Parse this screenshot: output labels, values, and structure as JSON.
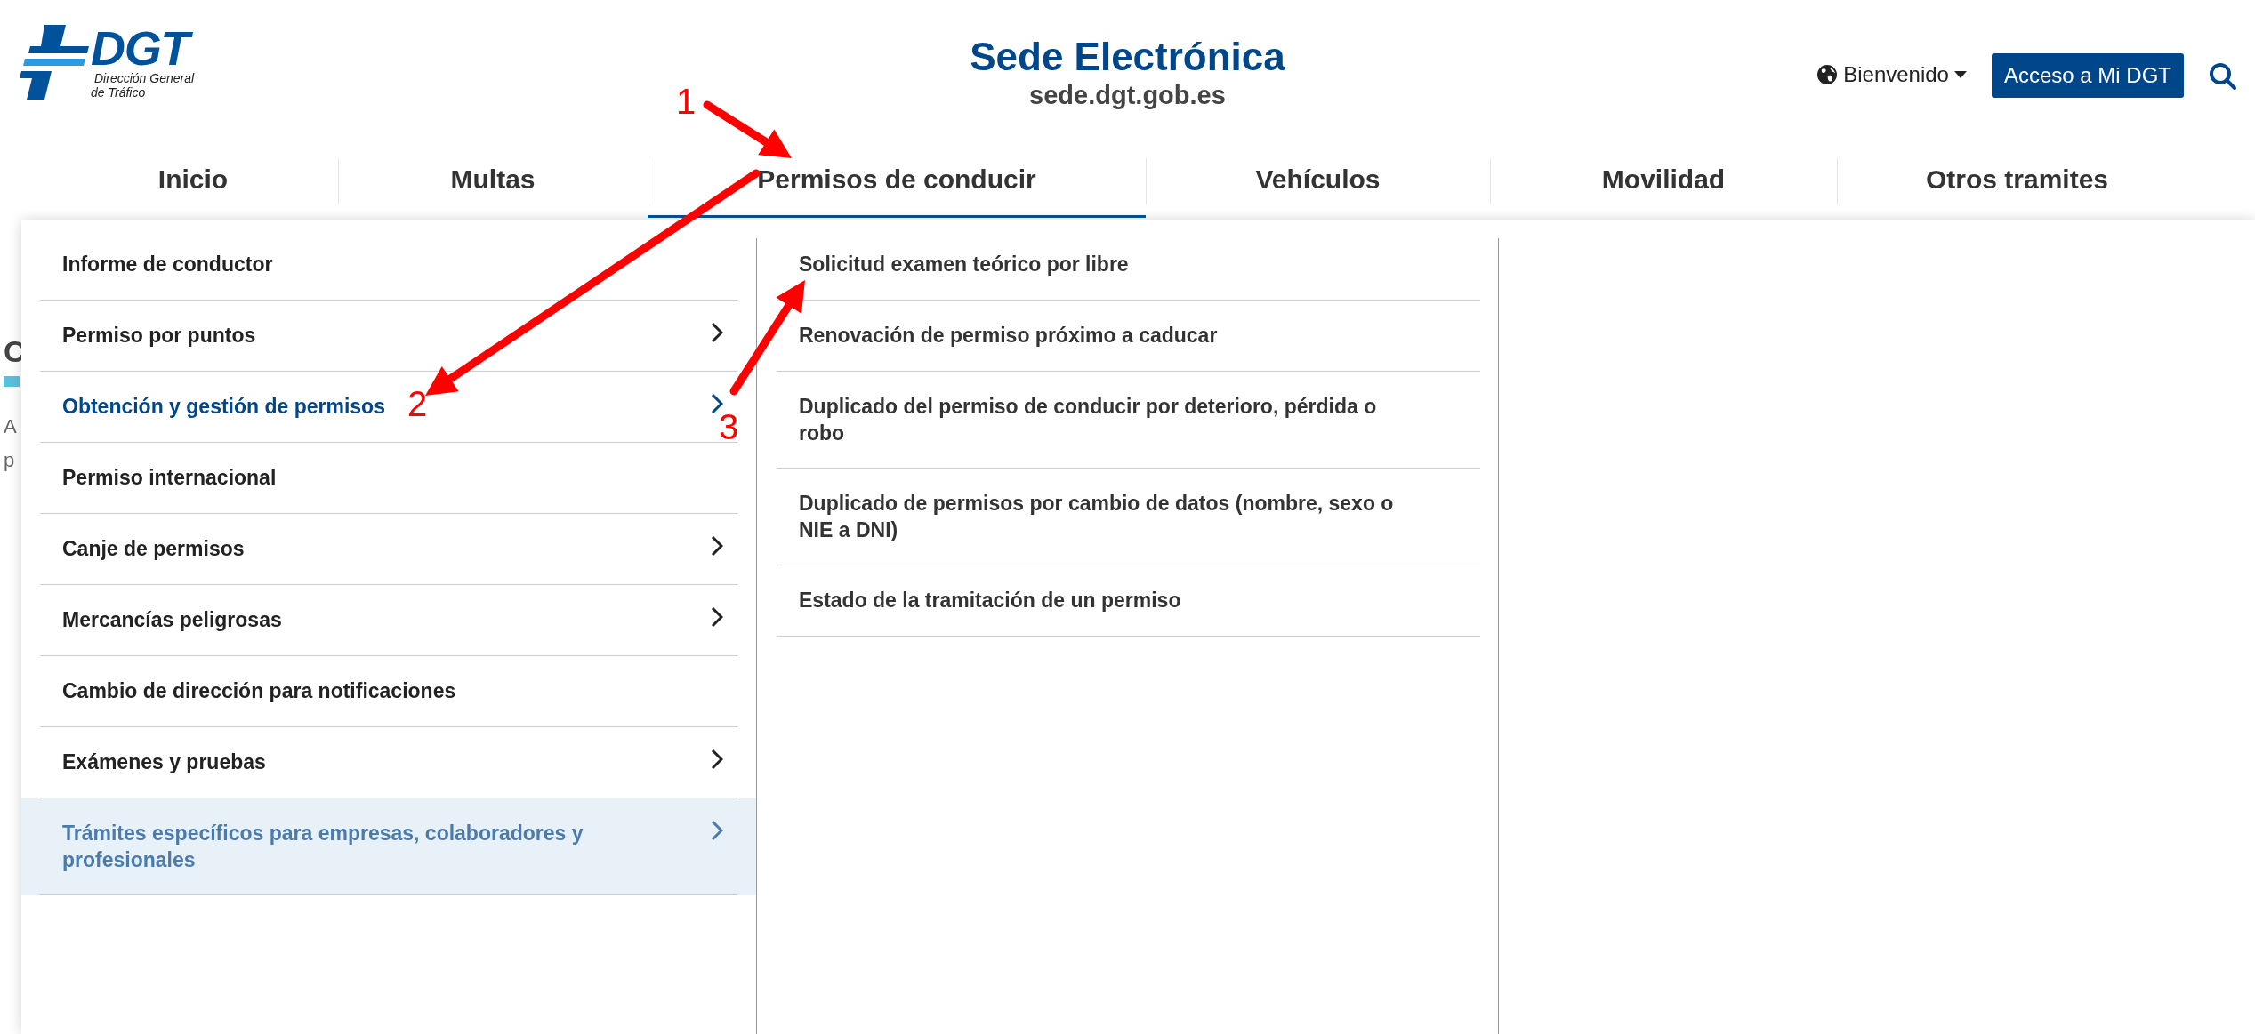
{
  "logo": {
    "mark": "DGT",
    "line_1": "Dirección General",
    "line_2": "de Tráfico"
  },
  "site": {
    "title": "Sede Electrónica",
    "address": "sede.dgt.gob.es"
  },
  "language_menu": {
    "label": "Bienvenido"
  },
  "login_button": {
    "label": "Acceso a Mi DGT"
  },
  "nav": [
    {
      "label": "Inicio",
      "selected": false
    },
    {
      "label": "Multas",
      "selected": false
    },
    {
      "label": "Permisos de conducir",
      "selected": true
    },
    {
      "label": "Vehículos",
      "selected": false
    },
    {
      "label": "Movilidad",
      "selected": false
    },
    {
      "label": "Otros tramites",
      "selected": false
    }
  ],
  "background_page": {
    "title": "C",
    "text_lines": [
      "A",
      "p"
    ]
  },
  "menu": {
    "items": [
      {
        "label": "Informe de conductor",
        "has_submenu": false,
        "selected": false,
        "hovered": false
      },
      {
        "label": "Permiso por puntos",
        "has_submenu": true,
        "selected": false,
        "hovered": false
      },
      {
        "label": "Obtención y gestión de permisos",
        "has_submenu": true,
        "selected": true,
        "hovered": false
      },
      {
        "label": "Permiso internacional",
        "has_submenu": false,
        "selected": false,
        "hovered": false
      },
      {
        "label": "Canje de permisos",
        "has_submenu": true,
        "selected": false,
        "hovered": false
      },
      {
        "label": "Mercancías peligrosas",
        "has_submenu": true,
        "selected": false,
        "hovered": false
      },
      {
        "label": "Cambio de dirección para notificaciones",
        "has_submenu": false,
        "selected": false,
        "hovered": false
      },
      {
        "label": "Exámenes y pruebas",
        "has_submenu": true,
        "selected": false,
        "hovered": false
      },
      {
        "label": "Trámites específicos para empresas, colaboradores y profesionales",
        "has_submenu": true,
        "selected": false,
        "hovered": true
      }
    ],
    "subitems": [
      {
        "label": "Solicitud examen teórico por libre"
      },
      {
        "label": "Renovación de permiso próximo a caducar"
      },
      {
        "label": "Duplicado del permiso de conducir por deterioro, pérdida o robo"
      },
      {
        "label": "Duplicado de permisos por cambio de datos (nombre, sexo o NIE a DNI)"
      },
      {
        "label": "Estado de la tramitación de un permiso"
      }
    ]
  },
  "annotations": [
    {
      "label": "1"
    },
    {
      "label": "2"
    },
    {
      "label": "3"
    }
  ]
}
